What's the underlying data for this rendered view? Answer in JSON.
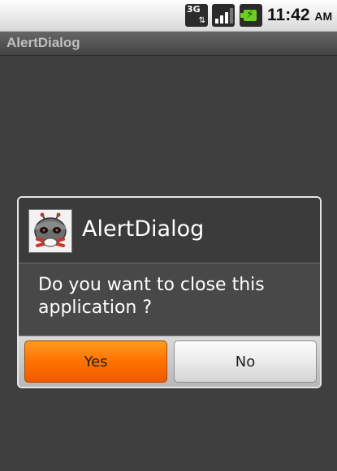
{
  "status_bar": {
    "network_type": "3G",
    "network_arrows": "⇅",
    "time": "11:42",
    "ampm": "AM",
    "icons": {
      "network": "network-3g-icon",
      "signal": "signal-strength-icon",
      "battery": "battery-charging-icon"
    },
    "battery_color": "#6bd11d"
  },
  "title_bar": {
    "title": "AlertDialog"
  },
  "dialog": {
    "icon": "android-app-icon",
    "title": "AlertDialog",
    "message": "Do you want to close this application ?",
    "buttons": {
      "positive": "Yes",
      "negative": "No"
    },
    "positive_color": "#ff7200"
  }
}
